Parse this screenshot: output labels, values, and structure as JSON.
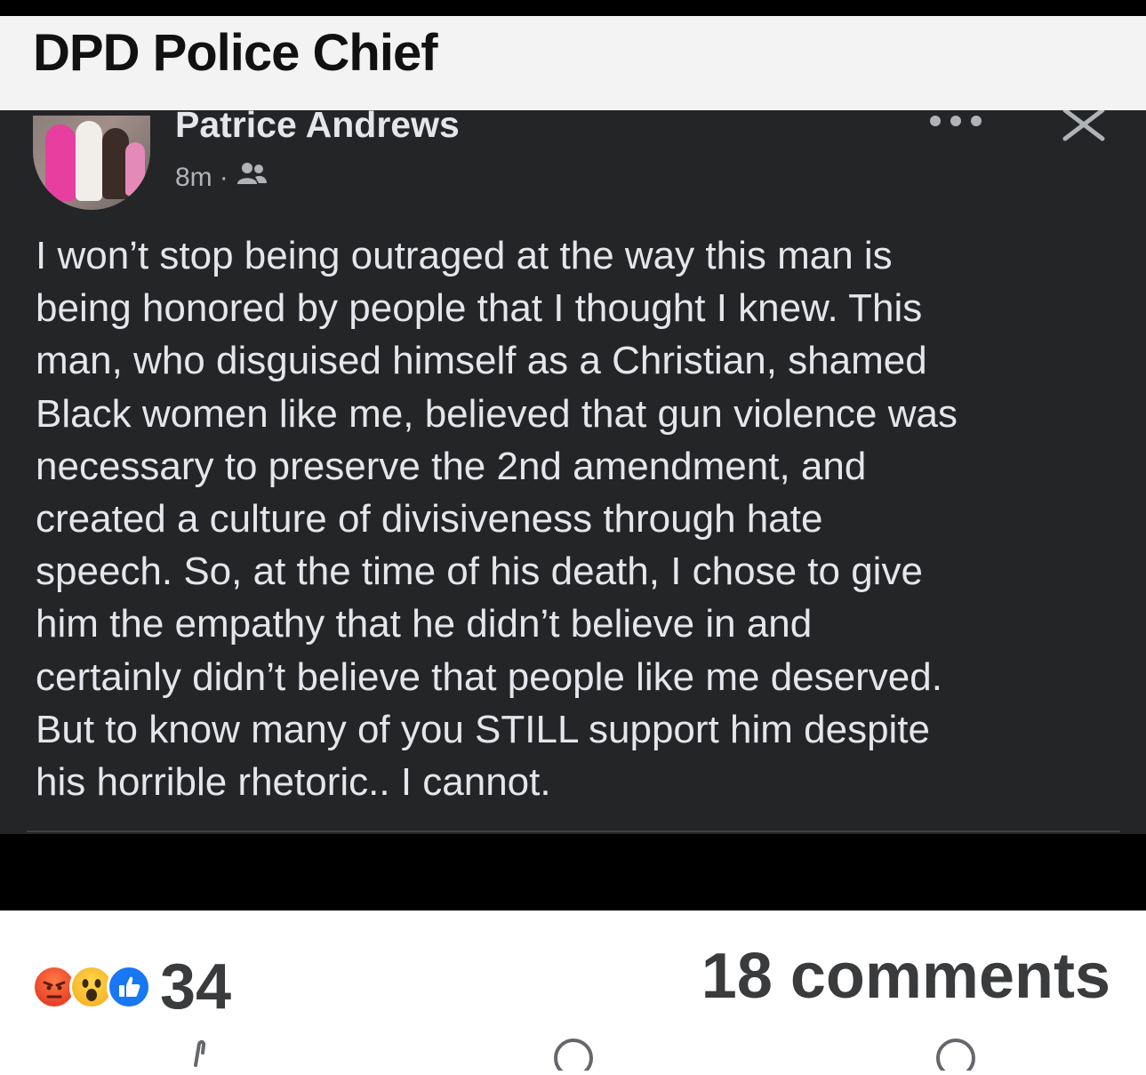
{
  "header": {
    "title": "DPD Police Chief"
  },
  "post": {
    "author": "Patrice Andrews",
    "time": "8m",
    "separator": "·",
    "audience_icon": "friends-icon",
    "text": "I won’t stop being outraged at the way this man is\nbeing honored by people that I thought I knew. This\nman, who disguised himself as a Christian, shamed\nBlack women like me, believed that gun violence was\nnecessary to preserve the 2nd amendment, and\ncreated a culture of divisiveness through hate\nspeech. So, at the time of his death,  I chose to give\nhim the empathy that he didn’t believe in and\ncertainly didn’t believe that people like me deserved.\nBut to know many of you STILL support him despite\nhis horrible rhetoric..  I cannot."
  },
  "footer": {
    "reactions": [
      "angry-reaction-icon",
      "wow-reaction-icon",
      "like-reaction-icon"
    ],
    "reaction_count": "34",
    "comments_count": "18 comments"
  },
  "colors": {
    "post_background": "#242526",
    "post_text": "#e4e6eb",
    "secondary_text": "#b0b3b8",
    "like_blue": "#1877f2"
  }
}
